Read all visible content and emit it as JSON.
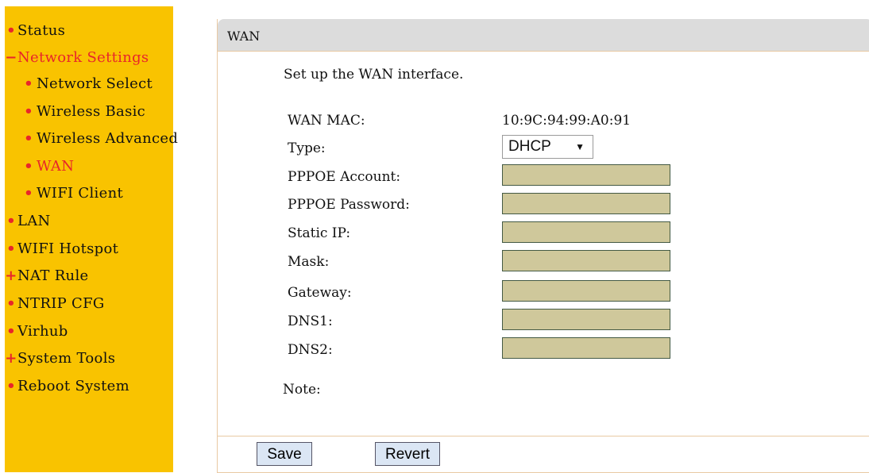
{
  "sidebar": {
    "items": [
      {
        "label": "Status",
        "marker": "•"
      },
      {
        "label": "Network Settings",
        "marker": "−"
      },
      {
        "label": "Network Select",
        "marker": "•"
      },
      {
        "label": "Wireless Basic",
        "marker": "•"
      },
      {
        "label": "Wireless Advanced",
        "marker": "•"
      },
      {
        "label": "WAN",
        "marker": "•"
      },
      {
        "label": "WIFI Client",
        "marker": "•"
      },
      {
        "label": "LAN",
        "marker": "•"
      },
      {
        "label": "WIFI Hotspot",
        "marker": "•"
      },
      {
        "label": "NAT Rule",
        "marker": "+"
      },
      {
        "label": "NTRIP CFG",
        "marker": "•"
      },
      {
        "label": "Virhub",
        "marker": "•"
      },
      {
        "label": "System Tools",
        "marker": "+"
      },
      {
        "label": "Reboot System",
        "marker": "•"
      }
    ]
  },
  "panel": {
    "title": "WAN",
    "intro": "Set up the WAN interface.",
    "fields": {
      "wan_mac_label": "WAN MAC:",
      "wan_mac_value": "10:9C:94:99:A0:91",
      "type_label": "Type:",
      "type_value": "DHCP",
      "pppoe_account_label": "PPPOE Account:",
      "pppoe_password_label": "PPPOE Password:",
      "static_ip_label": "Static IP:",
      "mask_label": "Mask:",
      "gateway_label": "Gateway:",
      "dns1_label": "DNS1:",
      "dns2_label": "DNS2:"
    },
    "note_label": "Note:",
    "save_label": "Save",
    "revert_label": "Revert"
  },
  "colors": {
    "sidebar_bg": "#f9c300",
    "active_text": "#e8262a",
    "input_bg": "#cfc89b",
    "header_bg": "#dcdcdc",
    "button_bg": "#dbe6f4"
  }
}
